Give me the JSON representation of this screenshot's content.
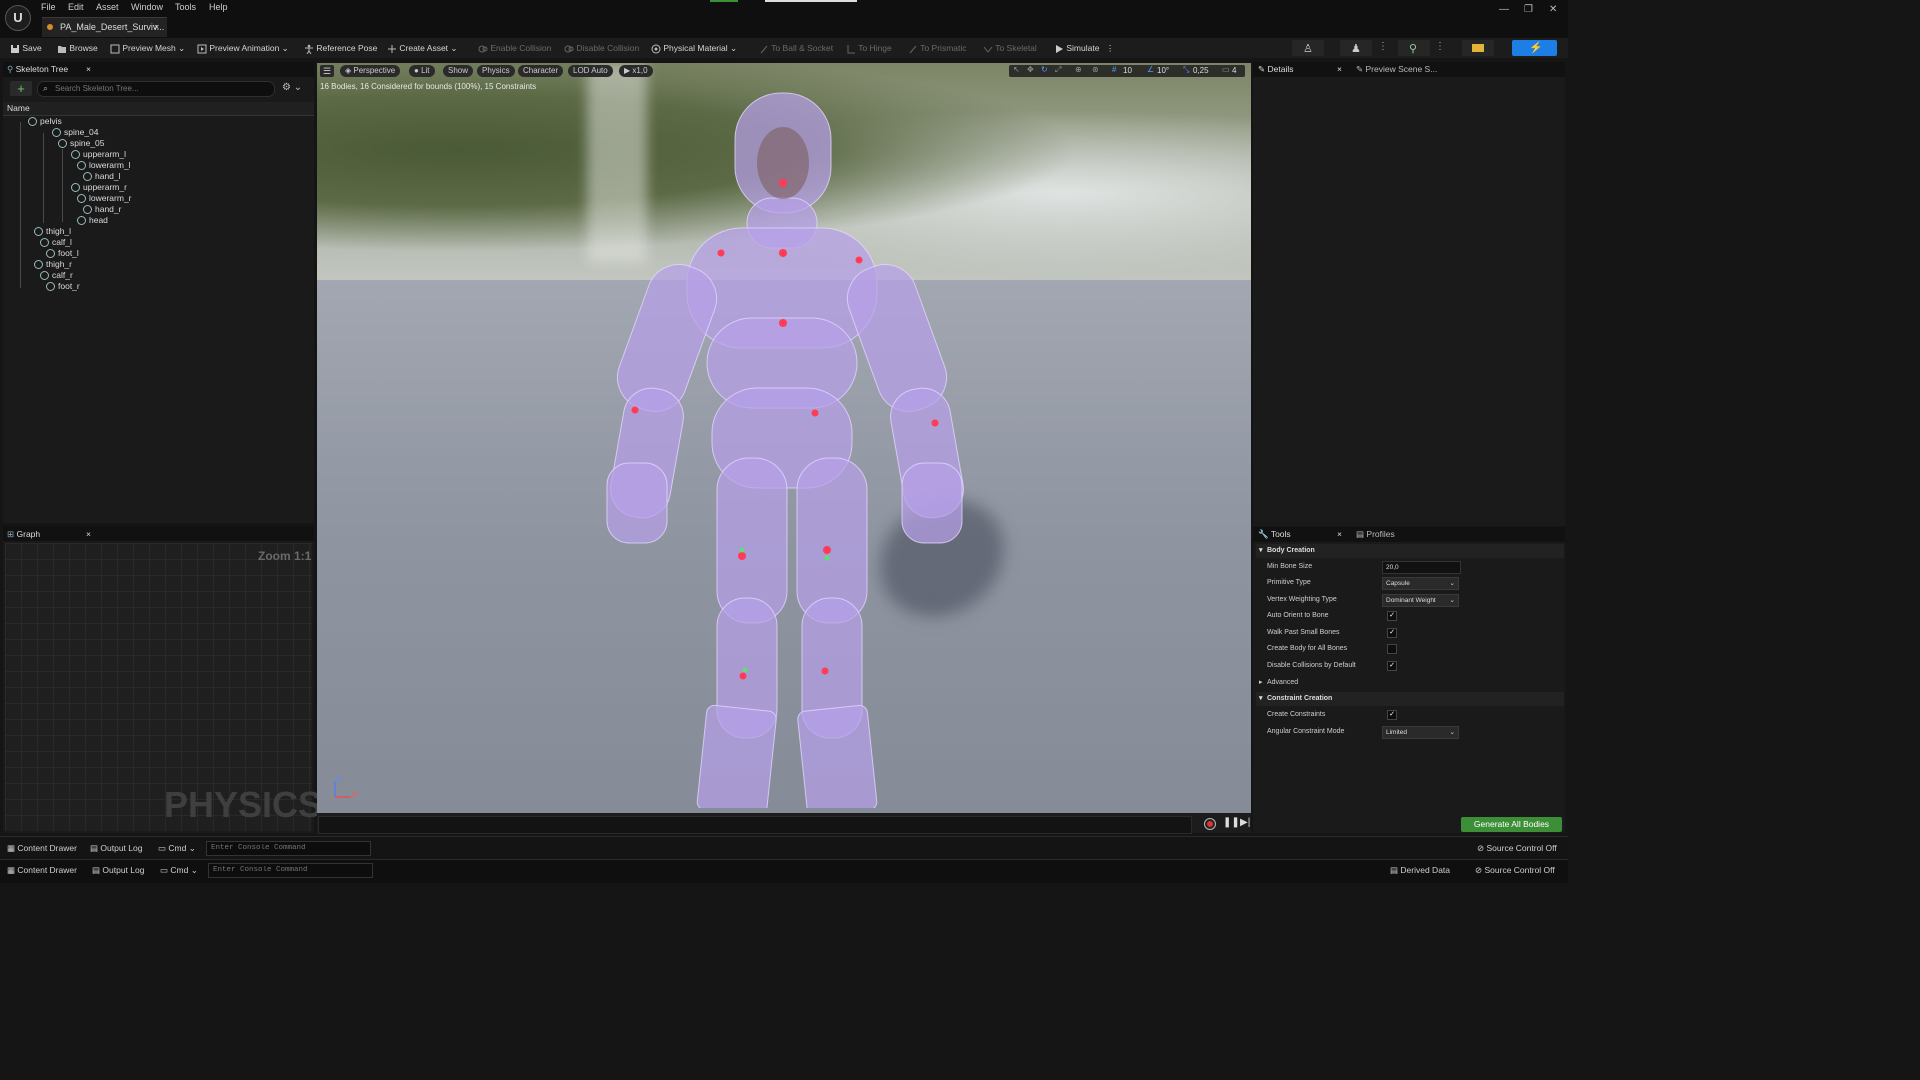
{
  "window": {
    "logo": "U",
    "doc_tab": "PA_Male_Desert_Surviv...",
    "tab_close": "×",
    "controls": [
      "—",
      "❐",
      "✕"
    ]
  },
  "menu": [
    "File",
    "Edit",
    "Asset",
    "Window",
    "Tools",
    "Help"
  ],
  "toolbar": {
    "save": "Save",
    "browse": "Browse",
    "preview_mesh": "Preview Mesh",
    "preview_animation": "Preview Animation",
    "reference_pose": "Reference Pose",
    "create_asset": "Create Asset",
    "enable_collision": "Enable Collision",
    "disable_collision": "Disable Collision",
    "physical_material": "Physical Material",
    "to_ball_socket": "To Ball & Socket",
    "to_hinge": "To Hinge",
    "to_prismatic": "To Prismatic",
    "to_skeletal": "To Skeletal",
    "simulate": "Simulate"
  },
  "skeleton_tree": {
    "tab": "Skeleton Tree",
    "close": "×",
    "search_placeholder": "Search Skeleton Tree...",
    "column": "Name",
    "bones": [
      "pelvis",
      "spine_04",
      "spine_05",
      "upperarm_l",
      "lowerarm_l",
      "hand_l",
      "upperarm_r",
      "lowerarm_r",
      "hand_r",
      "head",
      "thigh_l",
      "calf_l",
      "foot_l",
      "thigh_r",
      "calf_r",
      "foot_r"
    ]
  },
  "graph": {
    "tab": "Graph",
    "close": "×",
    "zoom": "Zoom 1:1",
    "watermark": "PHYSICS"
  },
  "viewport": {
    "perspective": "Perspective",
    "lit": "Lit",
    "show": "Show",
    "physics": "Physics",
    "character": "Character",
    "lod": "LOD Auto",
    "speed": "x1,0",
    "info": "16 Bodies, 16 Considered for bounds (100%), 15 Constraints",
    "grid": "10",
    "angle": "10°",
    "scale": "0,25",
    "cam": "4",
    "axis_z": "Z",
    "axis_x": "X"
  },
  "details": {
    "tab": "Details",
    "close": "×",
    "scene_tab": "Preview Scene S..."
  },
  "tools": {
    "tab": "Tools",
    "close": "×",
    "profiles_tab": "Profiles",
    "body_creation": "Body Creation",
    "min_bone_size_label": "Min Bone Size",
    "min_bone_size": "20,0",
    "primitive_type_label": "Primitive Type",
    "primitive_type": "Capsule",
    "vertex_weighting_label": "Vertex Weighting Type",
    "vertex_weighting": "Dominant Weight",
    "auto_orient_label": "Auto Orient to Bone",
    "auto_orient": true,
    "walk_past_label": "Walk Past Small Bones",
    "walk_past": true,
    "create_all_label": "Create Body for All Bones",
    "create_all": false,
    "disable_coll_label": "Disable Collisions by Default",
    "disable_coll": true,
    "advanced": "Advanced",
    "constraint_creation": "Constraint Creation",
    "create_constraints_label": "Create Constraints",
    "create_constraints": true,
    "angular_mode_label": "Angular Constraint Mode",
    "angular_mode": "Limited",
    "generate": "Generate All Bodies"
  },
  "bottom": {
    "content_drawer": "Content Drawer",
    "output_log": "Output Log",
    "cmd": "Cmd",
    "console_placeholder": "Enter Console Command",
    "source_control": "Source Control Off",
    "derived_data": "Derived Data"
  },
  "colors": {
    "accent_blue": "#1d7fe6",
    "generate_green": "#3c8e37",
    "body_purple": "#b9a6e6"
  }
}
